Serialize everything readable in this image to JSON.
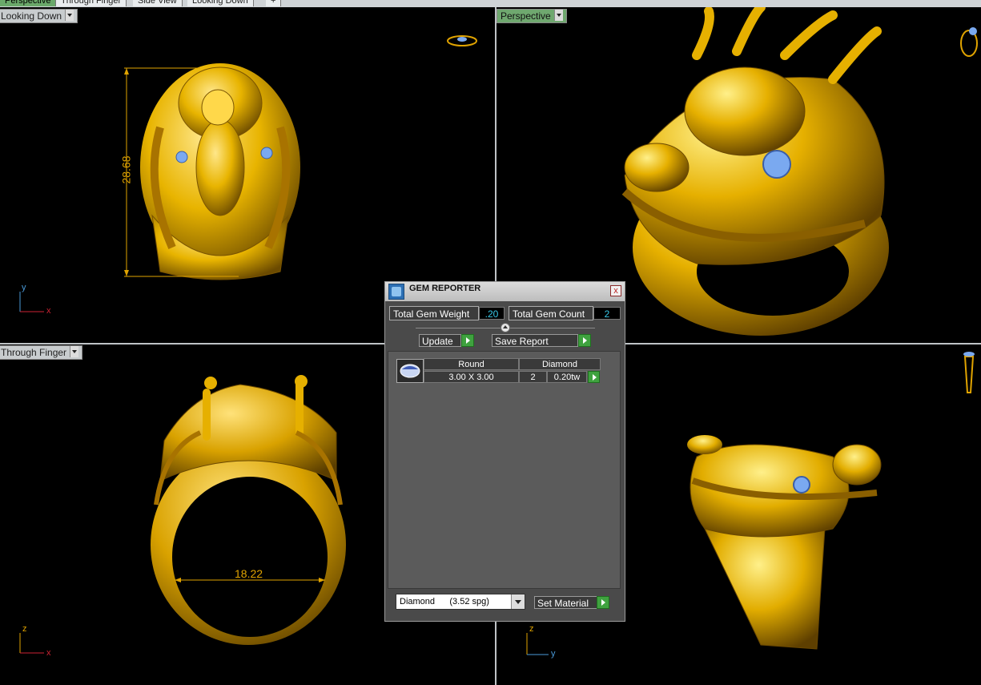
{
  "tabs": [
    "Perspective",
    "Through Finger",
    "Side View",
    "Looking Down",
    "+"
  ],
  "viewports": {
    "top_left": {
      "label": "Looking Down",
      "dimension": "28.68",
      "axis_v": "y",
      "axis_h": "x"
    },
    "top_right": {
      "label": "Perspective"
    },
    "bottom_left": {
      "label": "Through Finger",
      "dimension": "18.22",
      "axis_v": "z",
      "axis_h": "x"
    },
    "bottom_right": {
      "axis_v": "z",
      "axis_h": "y"
    }
  },
  "dialog": {
    "title": "GEM REPORTER",
    "close": "x",
    "total_gem_weight_label": "Total Gem Weight",
    "total_gem_weight": ".20",
    "total_gem_count_label": "Total Gem Count",
    "total_gem_count": "2",
    "update_label": "Update",
    "save_report_label": "Save Report",
    "gem_table": {
      "headers": [
        "Round",
        "Diamond"
      ],
      "row": {
        "size": "3.00 X 3.00",
        "count": "2",
        "weight": "0.20tw"
      }
    },
    "material_select": "Diamond      (3.52 spg)",
    "set_material_label": "Set Material"
  },
  "colors": {
    "gold": "#e0a300",
    "accent_green": "#3fa23f",
    "gem_blue": "#7aa9f0"
  }
}
